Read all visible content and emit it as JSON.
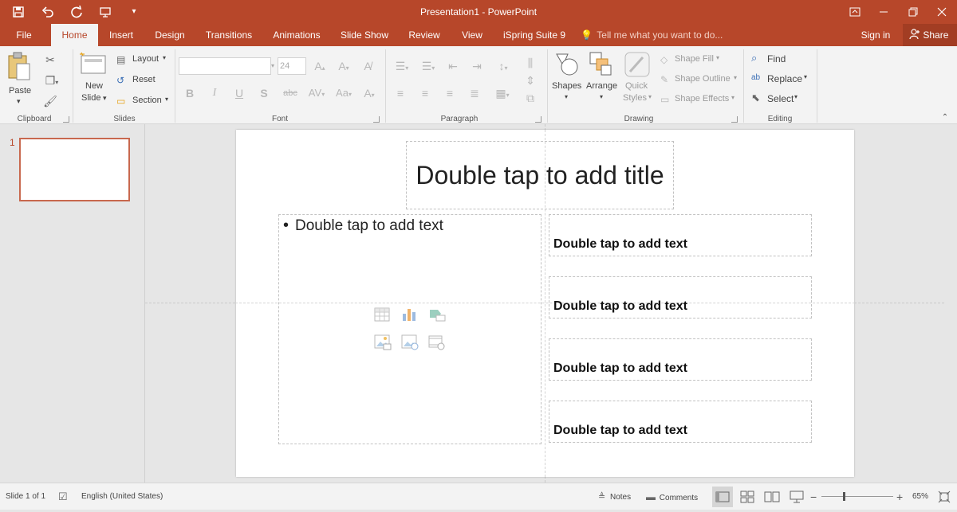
{
  "window": {
    "title": "Presentation1 - PowerPoint"
  },
  "quick_access": [
    {
      "icon": "save-icon"
    },
    {
      "icon": "undo-icon"
    },
    {
      "icon": "redo-icon"
    },
    {
      "icon": "present-from-beginning-icon"
    },
    {
      "icon": "customize-toolbar-icon"
    }
  ],
  "tabs": {
    "file": "File",
    "home": "Home",
    "insert": "Insert",
    "design": "Design",
    "transitions": "Transitions",
    "animations": "Animations",
    "slideshow": "Slide Show",
    "review": "Review",
    "view": "View",
    "ispring": "iSpring Suite 9",
    "tell_me": "Tell me what you want to do...",
    "sign_in": "Sign in",
    "share": "Share"
  },
  "ribbon": {
    "clipboard": {
      "paste": "Paste",
      "label": "Clipboard"
    },
    "slides": {
      "new_slide_line1": "New",
      "new_slide_line2": "Slide",
      "layout": "Layout",
      "reset": "Reset",
      "section": "Section",
      "label": "Slides"
    },
    "font": {
      "font_size": "24",
      "label": "Font"
    },
    "paragraph": {
      "label": "Paragraph"
    },
    "drawing": {
      "shapes": "Shapes",
      "arrange": "Arrange",
      "quick_styles_line1": "Quick",
      "quick_styles_line2": "Styles",
      "shape_fill": "Shape Fill",
      "shape_outline": "Shape Outline",
      "shape_effects": "Shape Effects",
      "label": "Drawing"
    },
    "editing": {
      "find": "Find",
      "replace": "Replace",
      "select": "Select",
      "label": "Editing"
    }
  },
  "thumbnails": {
    "slide_number": "1"
  },
  "slide": {
    "title_placeholder": "Double tap to add title",
    "content_placeholder": "Double tap to add text",
    "right_boxes": [
      "Double tap to add text",
      "Double tap to add text",
      "Double tap to add text",
      "Double tap to add text"
    ]
  },
  "statusbar": {
    "slide_info": "Slide 1 of 1",
    "language": "English (United States)",
    "notes": "Notes",
    "comments": "Comments",
    "zoom": "65%",
    "zoom_level": 0.65
  },
  "colors": {
    "accent": "#b7472a"
  }
}
